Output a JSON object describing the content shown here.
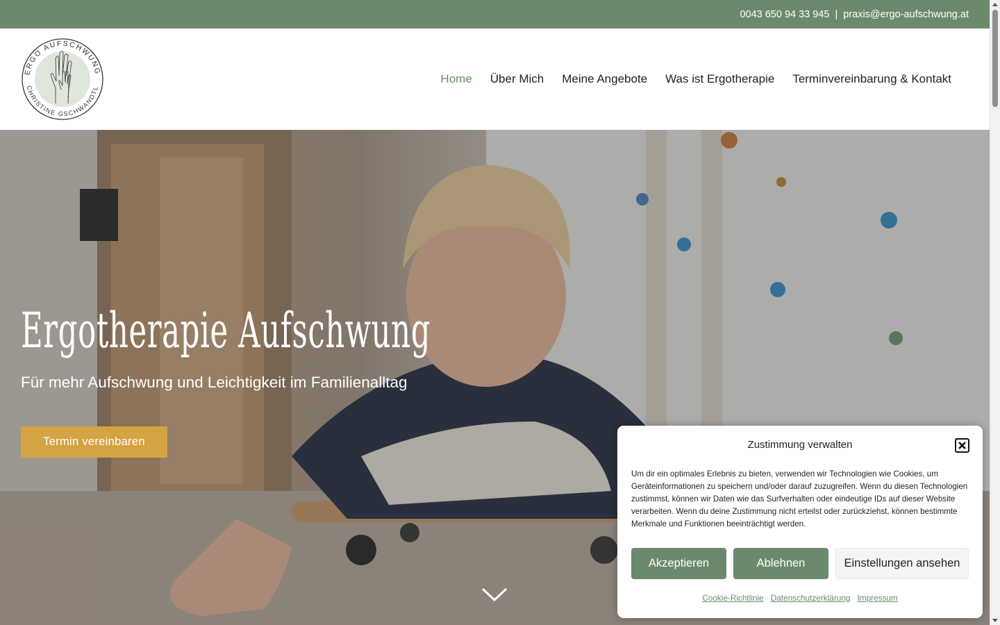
{
  "topbar": {
    "phone": "0043 650 94 33 945",
    "separator": "|",
    "email": "praxis@ergo-aufschwung.at",
    "bg_color": "#6b8a6d"
  },
  "logo": {
    "top_text": "ERGO AUFSCHWUNG",
    "bottom_text": "CHRISTINE GSCHWANDTL",
    "icon": "hand-in-hand-icon"
  },
  "nav": {
    "items": [
      {
        "label": "Home",
        "active": true
      },
      {
        "label": "Über Mich",
        "active": false
      },
      {
        "label": "Meine Angebote",
        "active": false
      },
      {
        "label": "Was ist Ergotherapie",
        "active": false
      },
      {
        "label": "Terminvereinbarung & Kontakt",
        "active": false
      }
    ],
    "active_color": "#6b8a6d"
  },
  "hero": {
    "title": "Ergotherapie Aufschwung",
    "subtitle": "Für mehr Aufschwung und Leichtigkeit im Familienalltag",
    "cta_label": "Termin vereinbaren",
    "cta_color": "#d4a344",
    "scroll_icon": "chevron-down-icon"
  },
  "consent": {
    "title": "Zustimmung verwalten",
    "close_icon": "close-icon",
    "text": "Um dir ein optimales Erlebnis zu bieten, verwenden wir Technologien wie Cookies, um Geräteinformationen zu speichern und/oder darauf zuzugreifen. Wenn du diesen Technologien zustimmst, können wir Daten wie das Surfverhalten oder eindeutige IDs auf dieser Website verarbeiten. Wenn du deine Zustimmung nicht erteilst oder zurückziehst, können bestimmte Merkmale und Funktionen beeinträchtigt werden.",
    "accept_label": "Akzeptieren",
    "deny_label": "Ablehnen",
    "settings_label": "Einstellungen ansehen",
    "links": [
      "Cookie-Richtlinie",
      "Datenschutzerklärung",
      "Impressum"
    ]
  }
}
